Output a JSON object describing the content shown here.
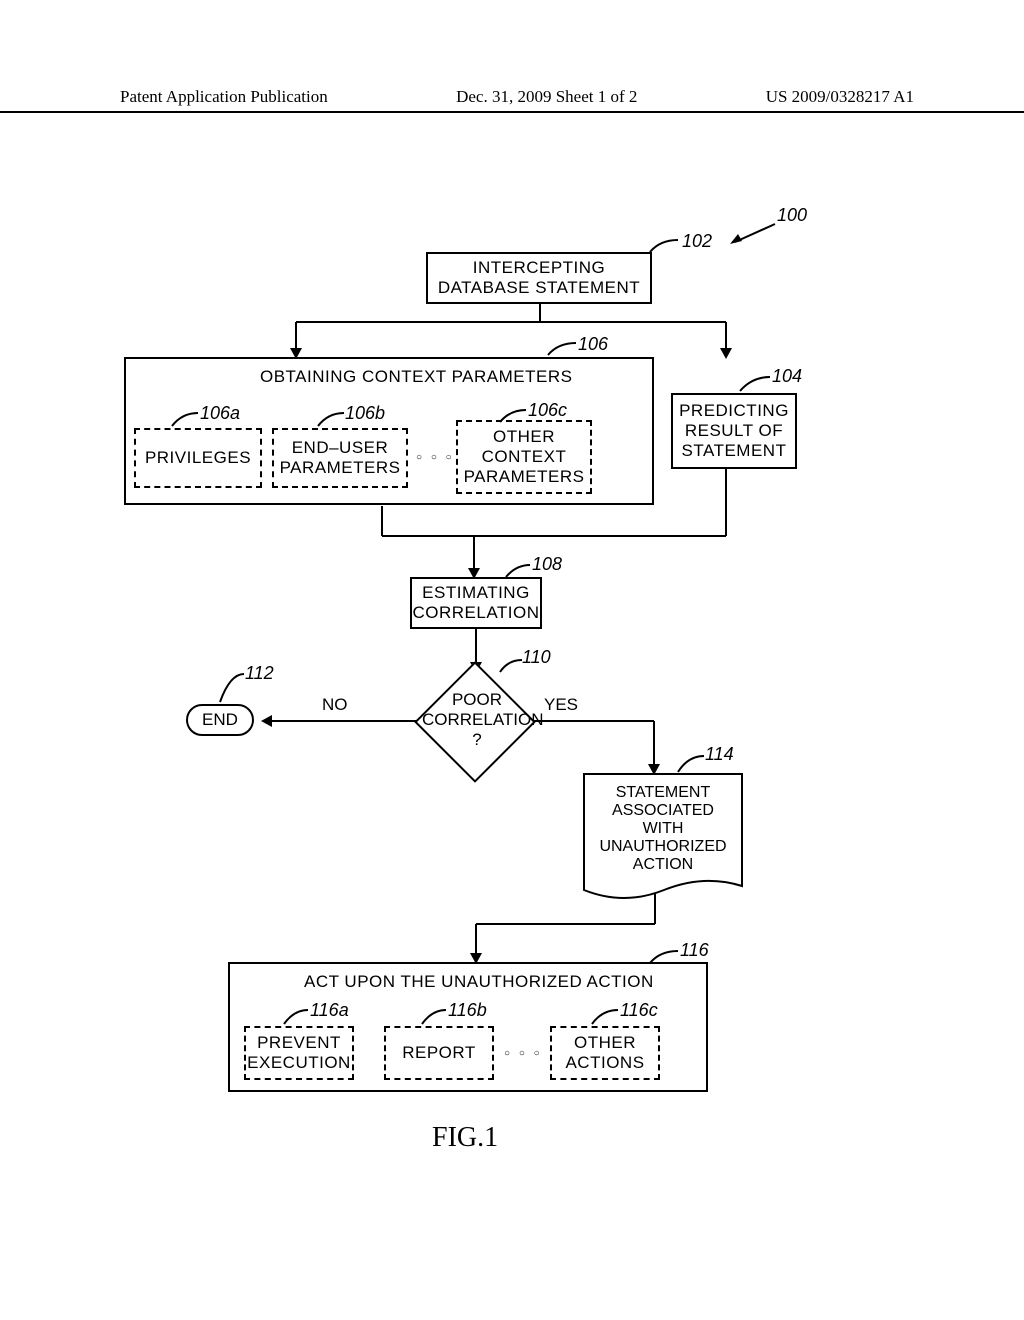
{
  "header": {
    "left": "Patent Application Publication",
    "center": "Dec. 31, 2009  Sheet 1 of 2",
    "right": "US 2009/0328217 A1"
  },
  "refs": {
    "r100": "100",
    "r102": "102",
    "r104": "104",
    "r106": "106",
    "r106a": "106a",
    "r106b": "106b",
    "r106c": "106c",
    "r108": "108",
    "r110": "110",
    "r112": "112",
    "r114": "114",
    "r116": "116",
    "r116a": "116a",
    "r116b": "116b",
    "r116c": "116c"
  },
  "blocks": {
    "b102_l1": "INTERCEPTING",
    "b102_l2": "DATABASE  STATEMENT",
    "b106_title": "OBTAINING  CONTEXT  PARAMETERS",
    "b106a": "PRIVILEGES",
    "b106b_l1": "END–USER",
    "b106b_l2": "PARAMETERS",
    "b106c_l1": "OTHER",
    "b106c_l2": "CONTEXT",
    "b106c_l3": "PARAMETERS",
    "b104_l1": "PREDICTING",
    "b104_l2": "RESULT OF",
    "b104_l3": "STATEMENT",
    "b108_l1": "ESTIMATING",
    "b108_l2": "CORRELATION",
    "diamond_l1": "POOR",
    "diamond_l2": "CORRELATION",
    "diamond_l3": "?",
    "end": "END",
    "b114_l1": "STATEMENT",
    "b114_l2": "ASSOCIATED",
    "b114_l3": "WITH",
    "b114_l4": "UNAUTHORIZED",
    "b114_l5": "ACTION",
    "b116_title": "ACT UPON THE UNAUTHORIZED ACTION",
    "b116a_l1": "PREVENT",
    "b116a_l2": "EXECUTION",
    "b116b": "REPORT",
    "b116c_l1": "OTHER",
    "b116c_l2": "ACTIONS"
  },
  "edges": {
    "no": "NO",
    "yes": "YES"
  },
  "figure": "FIG.1"
}
